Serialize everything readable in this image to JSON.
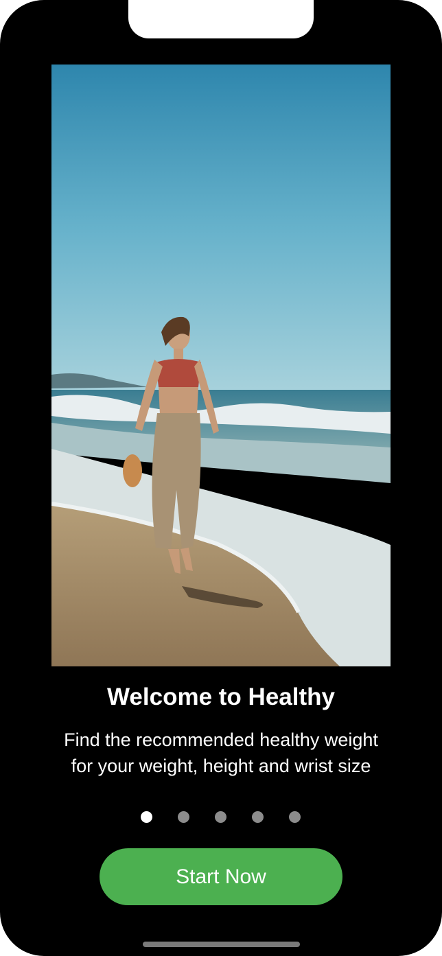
{
  "onboarding": {
    "title": "Welcome to Healthy",
    "subtitle_line1": "Find the recommended healthy weight",
    "subtitle_line2": "for your weight, height and wrist size",
    "page_count": 5,
    "current_page": 1,
    "cta_label": "Start Now"
  },
  "colors": {
    "background": "#000000",
    "accent": "#4cb050",
    "dot_active": "#ffffff",
    "dot_inactive": "#8c8c8c"
  }
}
